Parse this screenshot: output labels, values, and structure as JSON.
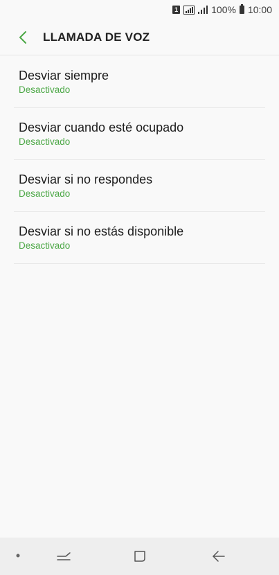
{
  "status_bar": {
    "sim": "1",
    "battery_percent": "100%",
    "time": "10:00"
  },
  "header": {
    "title": "LLAMADA DE VOZ",
    "back_icon": "chevron-left-icon"
  },
  "items": [
    {
      "title": "Desviar siempre",
      "status": "Desactivado"
    },
    {
      "title": "Desviar cuando esté ocupado",
      "status": "Desactivado"
    },
    {
      "title": "Desviar si no respondes",
      "status": "Desactivado"
    },
    {
      "title": "Desviar si no estás disponible",
      "status": "Desactivado"
    }
  ],
  "nav_bar": {
    "icons": [
      "dot-icon",
      "recents-icon",
      "home-icon",
      "back-arrow-icon"
    ]
  },
  "colors": {
    "accent": "#4da847",
    "background": "#f9f9f9",
    "nav_background": "#eeeeee"
  }
}
